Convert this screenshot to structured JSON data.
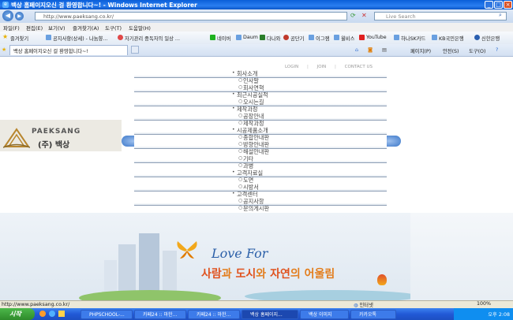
{
  "window": {
    "title": "백상 홈페이지오신 걸 환영합니다~! - Windows Internet Explorer"
  },
  "browser": {
    "address": "http://www.paeksang.co.kr/",
    "search_placeholder": "Live Search",
    "menu": [
      "파일(F)",
      "편집(E)",
      "보기(V)",
      "즐겨찾기(A)",
      "도구(T)",
      "도움말(H)"
    ],
    "favorites_label": "즐겨찾기",
    "favorites": [
      "공지사항(상세) - 나눔향...",
      "자기관리 중독자의 일상 ...",
      "네이버",
      "Daum",
      "다나와",
      "공단기",
      "이그잼",
      "윌비스",
      "YouTube",
      "하나SK카드",
      "KB국민은행",
      "신한은행"
    ],
    "tab_title": "백상 홈페이지오신 걸 환영합니다~!",
    "tools": [
      "페이지(P)",
      "안전(S)",
      "도구(O)"
    ]
  },
  "site": {
    "top_links": [
      "LOGIN",
      "JOIN",
      "CONTACT US"
    ],
    "logo_text": "PAEKSANG",
    "logo_korean": "(주) 백상",
    "menu_items": [
      {
        "label": "회사소개",
        "level": 1
      },
      {
        "label": "인사말",
        "level": 2
      },
      {
        "label": "회사연혁",
        "level": 2
      },
      {
        "label": "최근시공실적",
        "level": 1
      },
      {
        "label": "오시는길",
        "level": 2
      },
      {
        "label": "제작과정",
        "level": 1
      },
      {
        "label": "공장안내",
        "level": 2
      },
      {
        "label": "제작과정",
        "level": 2
      },
      {
        "label": "시공제품소개",
        "level": 1
      },
      {
        "label": "종합안내판",
        "level": 2
      },
      {
        "label": "방향안내판",
        "level": 2
      },
      {
        "label": "해설안내판",
        "level": 2
      },
      {
        "label": "기타",
        "level": 2
      },
      {
        "label": "과병",
        "level": 2
      },
      {
        "label": "고객자료실",
        "level": 1
      },
      {
        "label": "도면",
        "level": 2
      },
      {
        "label": "시방서",
        "level": 2
      },
      {
        "label": "고객센터",
        "level": 1
      },
      {
        "label": "공지사항",
        "level": 2
      },
      {
        "label": "문의게시판",
        "level": 2
      }
    ],
    "banner_title": "Love For",
    "banner_slogan_parts": [
      "사람",
      "과 ",
      "도시",
      "와 ",
      "자연",
      "의 어울림"
    ]
  },
  "status": {
    "url": "http://www.paeksang.co.kr/",
    "zone": "인터넷",
    "zoom": "100%"
  },
  "taskbar": {
    "start": "시작",
    "tasks": [
      "PHPSCHOOL-...",
      "카페24 :: 마한...",
      "카페24 :: 마한...",
      "백상 홈페이지...",
      "백상 이미지",
      "카카오톡"
    ],
    "clock": "오후 2:08"
  },
  "colors": {
    "titlebar": "#0a5ed8",
    "taskbar": "#2259d6",
    "accent_orange": "#e37d1c",
    "love_blue": "#2b5fa8"
  }
}
